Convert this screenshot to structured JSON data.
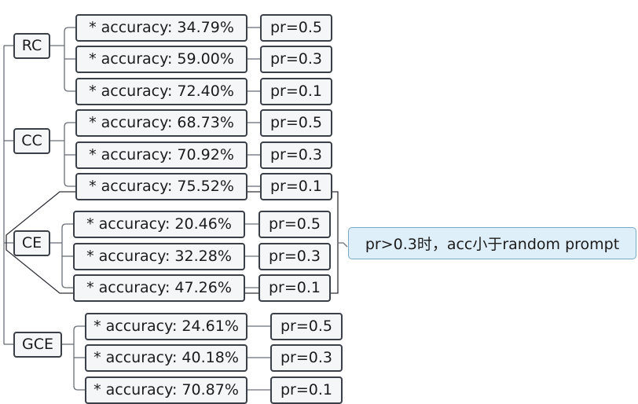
{
  "groups": [
    {
      "label": "RC",
      "rows": [
        {
          "acc": "* accuracy: 34.79%",
          "pr": "pr=0.5"
        },
        {
          "acc": "* accuracy: 59.00%",
          "pr": "pr=0.3"
        },
        {
          "acc": "* accuracy: 72.40%",
          "pr": "pr=0.1"
        }
      ]
    },
    {
      "label": "CC",
      "rows": [
        {
          "acc": "* accuracy: 68.73%",
          "pr": "pr=0.5"
        },
        {
          "acc": "* accuracy: 70.92%",
          "pr": "pr=0.3"
        },
        {
          "acc": "* accuracy: 75.52%",
          "pr": "pr=0.1"
        }
      ]
    },
    {
      "label": "CE",
      "rows": [
        {
          "acc": "* accuracy: 20.46%",
          "pr": "pr=0.5"
        },
        {
          "acc": "* accuracy: 32.28%",
          "pr": "pr=0.3"
        },
        {
          "acc": "* accuracy: 47.26%",
          "pr": "pr=0.1"
        }
      ]
    },
    {
      "label": "GCE",
      "rows": [
        {
          "acc": "* accuracy: 24.61%",
          "pr": "pr=0.5"
        },
        {
          "acc": "* accuracy: 40.18%",
          "pr": "pr=0.3"
        },
        {
          "acc": "* accuracy: 70.87%",
          "pr": "pr=0.1"
        }
      ]
    }
  ],
  "note": "pr>0.3时，acc小于random prompt",
  "colors": {
    "box_fill": "#f5f6f8",
    "box_border": "#3b3f48",
    "note_fill": "#dfeff9",
    "note_border": "#7aa9c4"
  }
}
